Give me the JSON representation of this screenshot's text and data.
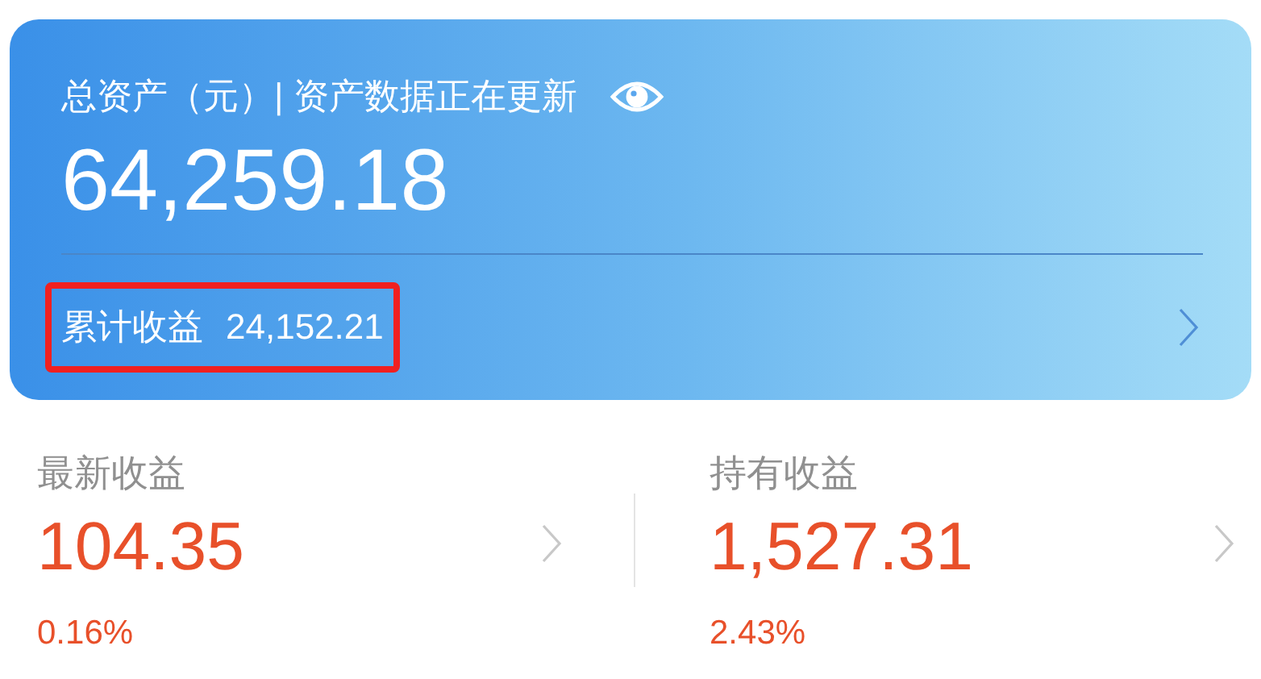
{
  "assets_card": {
    "title": "总资产（元）| 资产数据正在更新",
    "amount_visible": true,
    "total": "64,259.18",
    "cumulative": {
      "label": "累计收益",
      "value": "24,152.21",
      "highlighted": true
    }
  },
  "stats": [
    {
      "label": "最新收益",
      "value": "104.35",
      "percent": "0.16%"
    },
    {
      "label": "持有收益",
      "value": "1,527.31",
      "percent": "2.43%"
    }
  ]
}
